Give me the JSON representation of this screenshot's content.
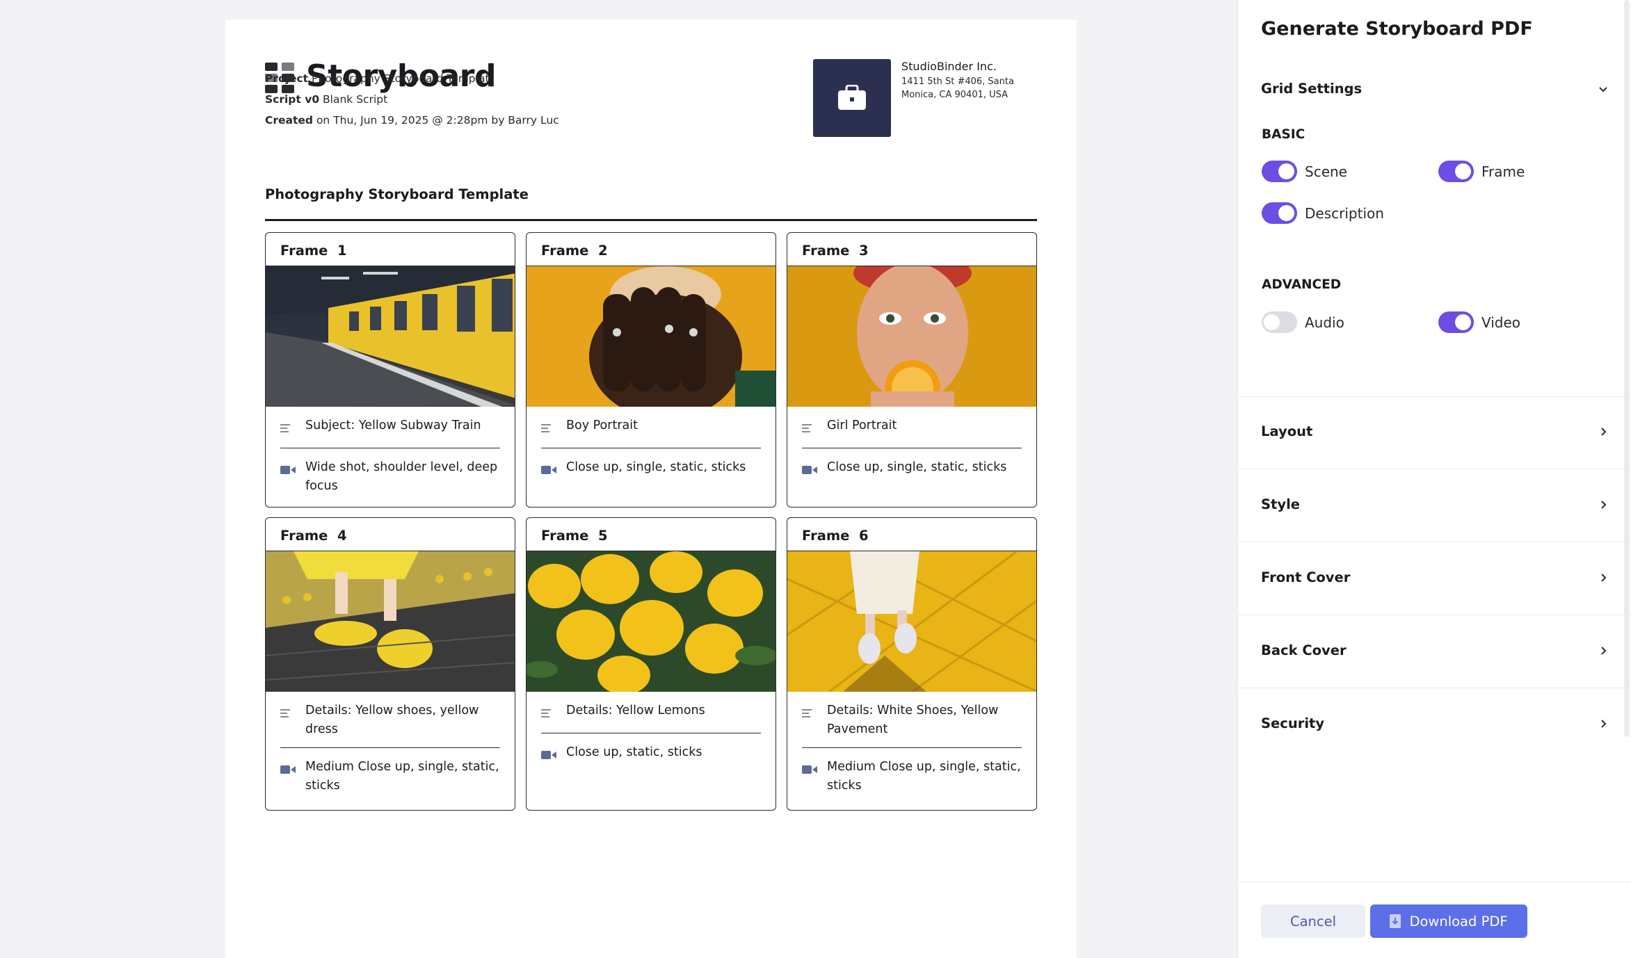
{
  "document": {
    "title": "Storyboard",
    "project_label": "Project",
    "project_value": "Photography Storyboard Templat",
    "script_label": "Script v0",
    "script_value": "Blank Script",
    "created_label": "Created",
    "created_value": "on Thu, Jun 19, 2025 @ 2:28pm by Barry Luc",
    "company_name": "StudioBinder Inc.",
    "company_address": "1411 5th St #406, Santa Monica, CA 90401, USA",
    "section_title": "Photography Storyboard Template",
    "frame_label": "Frame",
    "frames": [
      {
        "number": "1",
        "image": "yellow-subway-train",
        "description": "Subject: Yellow Subway Train",
        "camera": "Wide shot, shoulder level, deep focus"
      },
      {
        "number": "2",
        "image": "boy-portrait",
        "description": "Boy Portrait",
        "camera": "Close up, single, static, sticks"
      },
      {
        "number": "3",
        "image": "girl-portrait",
        "description": "Girl Portrait",
        "camera": "Close up, single, static, sticks"
      },
      {
        "number": "4",
        "image": "yellow-shoes",
        "description": "Details: Yellow shoes, yellow dress",
        "camera": "Medium Close up, single, static, sticks"
      },
      {
        "number": "5",
        "image": "yellow-lemons",
        "description": "Details: Yellow Lemons",
        "camera": "Close up, static, sticks"
      },
      {
        "number": "6",
        "image": "white-shoes-yellow-pavement",
        "description": "Details: White Shoes, Yellow Pavement",
        "camera": "Medium Close up, single, static, sticks"
      }
    ]
  },
  "panel": {
    "title": "Generate Storyboard PDF",
    "grid_settings": {
      "label": "Grid Settings",
      "basic_label": "BASIC",
      "advanced_label": "ADVANCED",
      "toggles": {
        "scene": {
          "label": "Scene",
          "on": true
        },
        "frame": {
          "label": "Frame",
          "on": true
        },
        "description": {
          "label": "Description",
          "on": true
        },
        "audio": {
          "label": "Audio",
          "on": false
        },
        "video": {
          "label": "Video",
          "on": true
        }
      }
    },
    "sections": [
      "Layout",
      "Style",
      "Front Cover",
      "Back Cover",
      "Security"
    ],
    "cancel_label": "Cancel",
    "download_label": "Download PDF"
  },
  "colors": {
    "accent_toggle": "#6c4de6",
    "download_button": "#5a6fe8",
    "company_logo_bg": "#2b3050"
  }
}
